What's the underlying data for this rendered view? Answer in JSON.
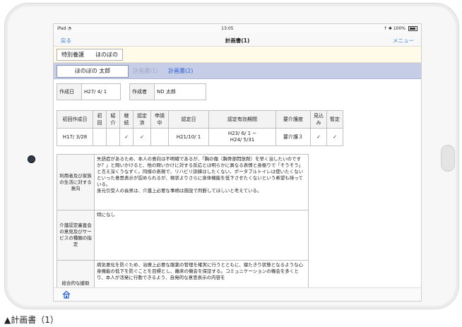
{
  "status_bar": {
    "left": "iPad",
    "wifi": "wifi-icon",
    "time": "13:05",
    "right": "↑ ✱ 100%"
  },
  "nav": {
    "back": "戻る",
    "title": "計画書(1)",
    "menu": "メニュー"
  },
  "facility": {
    "label": "特別養護　　ほのぼの"
  },
  "tabs": {
    "person": "ほのぼの 太郎",
    "plan1": "計画書(1)",
    "plan2": "計画書(2)"
  },
  "created": {
    "date_label": "作成日",
    "date_value": "H27/ 4/ 1",
    "author_label": "作成者",
    "author_value": "ND 太郎"
  },
  "care_info": {
    "headers": [
      "初回作成日",
      "初回",
      "紹介",
      "継続",
      "認定済",
      "申請中",
      "認定日",
      "認定有効期間",
      "要介護度",
      "見込み",
      "暫定"
    ],
    "values": [
      "H17/ 3/28",
      "",
      "",
      "✓",
      "✓",
      "",
      "H21/10/ 1",
      "H23/ 6/ 1 ~\nH24/ 5/31",
      "要介護３",
      "✓",
      "✓"
    ]
  },
  "sections": [
    {
      "label": "利用者及び家族の生活に対する意向",
      "text": "失語症があるため、本人の意向は不明確であるが、「胸の傷（胸骨部悶放剤）を早く治したいのですか？」と問いかけると、他の問いかけに対する反応とは明らかに異なる表情と身振りで「そうそう」と言え深くうなずく。同様の表現で、リハビリ訓練はしたくない、ポータブルトイレは使いたくないといった意思表示が認められるが、現状よりさらに身体機能を低下させたくないという希望も持っている。\n身元引受人の長男は、介護上必要な事柄は施設で判断してほしいと考えている。"
    },
    {
      "label": "介護認定審査会の意見及びサービスの種類の指定",
      "text": "特になし"
    },
    {
      "label": "総合的な援助",
      "text": "病気悪化を防ぐため、治療上必要な服薬の管理を確実に行うとともに、寝たきり状態となるような心身機能の低下を防ぐことを目標とし、離床の機会を保証する。コミュニケーションの機会を多くとり、本人が活発に行動できるよう、自発的な意思表示の内容を"
    }
  ],
  "toolbar": {
    "home_icon": "home-icon"
  },
  "caption": "▲計画書（1）"
}
